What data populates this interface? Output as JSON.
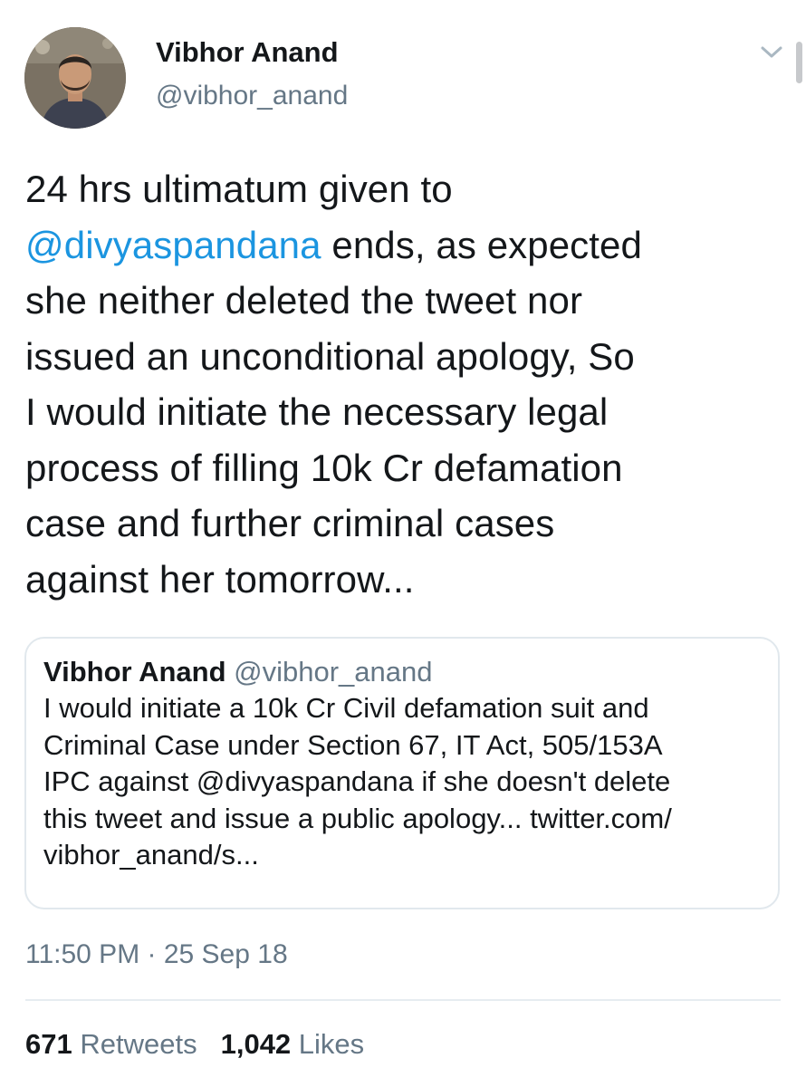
{
  "tweet": {
    "author": {
      "display_name": "Vibhor Anand",
      "handle": "@vibhor_anand",
      "avatar_icon": "user-avatar-photo"
    },
    "menu_icon": "chevron-down-icon",
    "text_lines": [
      [
        {
          "text": "24 hrs ultimatum given to",
          "type": "plain"
        }
      ],
      [
        {
          "text": "@divyaspandana",
          "type": "mention"
        },
        {
          "text": " ends, as expected",
          "type": "plain"
        }
      ],
      [
        {
          "text": "she neither deleted the tweet nor",
          "type": "plain"
        }
      ],
      [
        {
          "text": "issued an unconditional apology, So",
          "type": "plain"
        }
      ],
      [
        {
          "text": "I would initiate the necessary legal",
          "type": "plain"
        }
      ],
      [
        {
          "text": "process of filling 10k Cr defamation",
          "type": "plain"
        }
      ],
      [
        {
          "text": "case and further criminal cases",
          "type": "plain"
        }
      ],
      [
        {
          "text": "against her tomorrow...",
          "type": "plain"
        }
      ]
    ],
    "quoted_tweet": {
      "display_name": "Vibhor Anand",
      "handle": "@vibhor_anand",
      "text_lines": [
        "I would initiate a 10k Cr Civil defamation suit and",
        "Criminal Case under Section 67, IT Act, 505/153A",
        "IPC against @divyaspandana if she doesn't delete",
        "this tweet and issue a public apology... twitter.com/",
        "vibhor_anand/s..."
      ]
    },
    "timestamp": "11:50 PM · 25 Sep 18",
    "stats": {
      "retweets_count": "671",
      "retweets_label": "Retweets",
      "likes_count": "1,042",
      "likes_label": "Likes"
    }
  },
  "colors": {
    "mention": "#1b95e0",
    "secondary_text": "#657786",
    "primary_text": "#14171a",
    "border": "#e1e8ed"
  }
}
